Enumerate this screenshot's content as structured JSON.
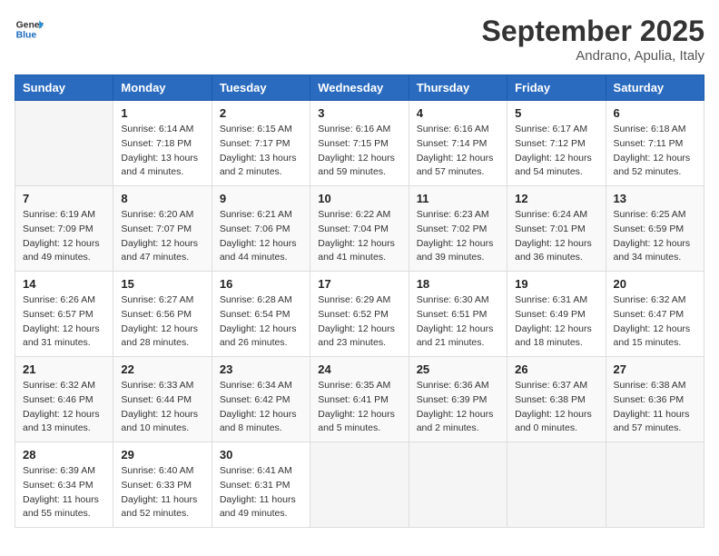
{
  "logo": {
    "line1": "General",
    "line2": "Blue"
  },
  "title": "September 2025",
  "location": "Andrano, Apulia, Italy",
  "weekdays": [
    "Sunday",
    "Monday",
    "Tuesday",
    "Wednesday",
    "Thursday",
    "Friday",
    "Saturday"
  ],
  "weeks": [
    [
      {
        "day": "",
        "info": ""
      },
      {
        "day": "1",
        "info": "Sunrise: 6:14 AM\nSunset: 7:18 PM\nDaylight: 13 hours\nand 4 minutes."
      },
      {
        "day": "2",
        "info": "Sunrise: 6:15 AM\nSunset: 7:17 PM\nDaylight: 13 hours\nand 2 minutes."
      },
      {
        "day": "3",
        "info": "Sunrise: 6:16 AM\nSunset: 7:15 PM\nDaylight: 12 hours\nand 59 minutes."
      },
      {
        "day": "4",
        "info": "Sunrise: 6:16 AM\nSunset: 7:14 PM\nDaylight: 12 hours\nand 57 minutes."
      },
      {
        "day": "5",
        "info": "Sunrise: 6:17 AM\nSunset: 7:12 PM\nDaylight: 12 hours\nand 54 minutes."
      },
      {
        "day": "6",
        "info": "Sunrise: 6:18 AM\nSunset: 7:11 PM\nDaylight: 12 hours\nand 52 minutes."
      }
    ],
    [
      {
        "day": "7",
        "info": "Sunrise: 6:19 AM\nSunset: 7:09 PM\nDaylight: 12 hours\nand 49 minutes."
      },
      {
        "day": "8",
        "info": "Sunrise: 6:20 AM\nSunset: 7:07 PM\nDaylight: 12 hours\nand 47 minutes."
      },
      {
        "day": "9",
        "info": "Sunrise: 6:21 AM\nSunset: 7:06 PM\nDaylight: 12 hours\nand 44 minutes."
      },
      {
        "day": "10",
        "info": "Sunrise: 6:22 AM\nSunset: 7:04 PM\nDaylight: 12 hours\nand 41 minutes."
      },
      {
        "day": "11",
        "info": "Sunrise: 6:23 AM\nSunset: 7:02 PM\nDaylight: 12 hours\nand 39 minutes."
      },
      {
        "day": "12",
        "info": "Sunrise: 6:24 AM\nSunset: 7:01 PM\nDaylight: 12 hours\nand 36 minutes."
      },
      {
        "day": "13",
        "info": "Sunrise: 6:25 AM\nSunset: 6:59 PM\nDaylight: 12 hours\nand 34 minutes."
      }
    ],
    [
      {
        "day": "14",
        "info": "Sunrise: 6:26 AM\nSunset: 6:57 PM\nDaylight: 12 hours\nand 31 minutes."
      },
      {
        "day": "15",
        "info": "Sunrise: 6:27 AM\nSunset: 6:56 PM\nDaylight: 12 hours\nand 28 minutes."
      },
      {
        "day": "16",
        "info": "Sunrise: 6:28 AM\nSunset: 6:54 PM\nDaylight: 12 hours\nand 26 minutes."
      },
      {
        "day": "17",
        "info": "Sunrise: 6:29 AM\nSunset: 6:52 PM\nDaylight: 12 hours\nand 23 minutes."
      },
      {
        "day": "18",
        "info": "Sunrise: 6:30 AM\nSunset: 6:51 PM\nDaylight: 12 hours\nand 21 minutes."
      },
      {
        "day": "19",
        "info": "Sunrise: 6:31 AM\nSunset: 6:49 PM\nDaylight: 12 hours\nand 18 minutes."
      },
      {
        "day": "20",
        "info": "Sunrise: 6:32 AM\nSunset: 6:47 PM\nDaylight: 12 hours\nand 15 minutes."
      }
    ],
    [
      {
        "day": "21",
        "info": "Sunrise: 6:32 AM\nSunset: 6:46 PM\nDaylight: 12 hours\nand 13 minutes."
      },
      {
        "day": "22",
        "info": "Sunrise: 6:33 AM\nSunset: 6:44 PM\nDaylight: 12 hours\nand 10 minutes."
      },
      {
        "day": "23",
        "info": "Sunrise: 6:34 AM\nSunset: 6:42 PM\nDaylight: 12 hours\nand 8 minutes."
      },
      {
        "day": "24",
        "info": "Sunrise: 6:35 AM\nSunset: 6:41 PM\nDaylight: 12 hours\nand 5 minutes."
      },
      {
        "day": "25",
        "info": "Sunrise: 6:36 AM\nSunset: 6:39 PM\nDaylight: 12 hours\nand 2 minutes."
      },
      {
        "day": "26",
        "info": "Sunrise: 6:37 AM\nSunset: 6:38 PM\nDaylight: 12 hours\nand 0 minutes."
      },
      {
        "day": "27",
        "info": "Sunrise: 6:38 AM\nSunset: 6:36 PM\nDaylight: 11 hours\nand 57 minutes."
      }
    ],
    [
      {
        "day": "28",
        "info": "Sunrise: 6:39 AM\nSunset: 6:34 PM\nDaylight: 11 hours\nand 55 minutes."
      },
      {
        "day": "29",
        "info": "Sunrise: 6:40 AM\nSunset: 6:33 PM\nDaylight: 11 hours\nand 52 minutes."
      },
      {
        "day": "30",
        "info": "Sunrise: 6:41 AM\nSunset: 6:31 PM\nDaylight: 11 hours\nand 49 minutes."
      },
      {
        "day": "",
        "info": ""
      },
      {
        "day": "",
        "info": ""
      },
      {
        "day": "",
        "info": ""
      },
      {
        "day": "",
        "info": ""
      }
    ]
  ]
}
